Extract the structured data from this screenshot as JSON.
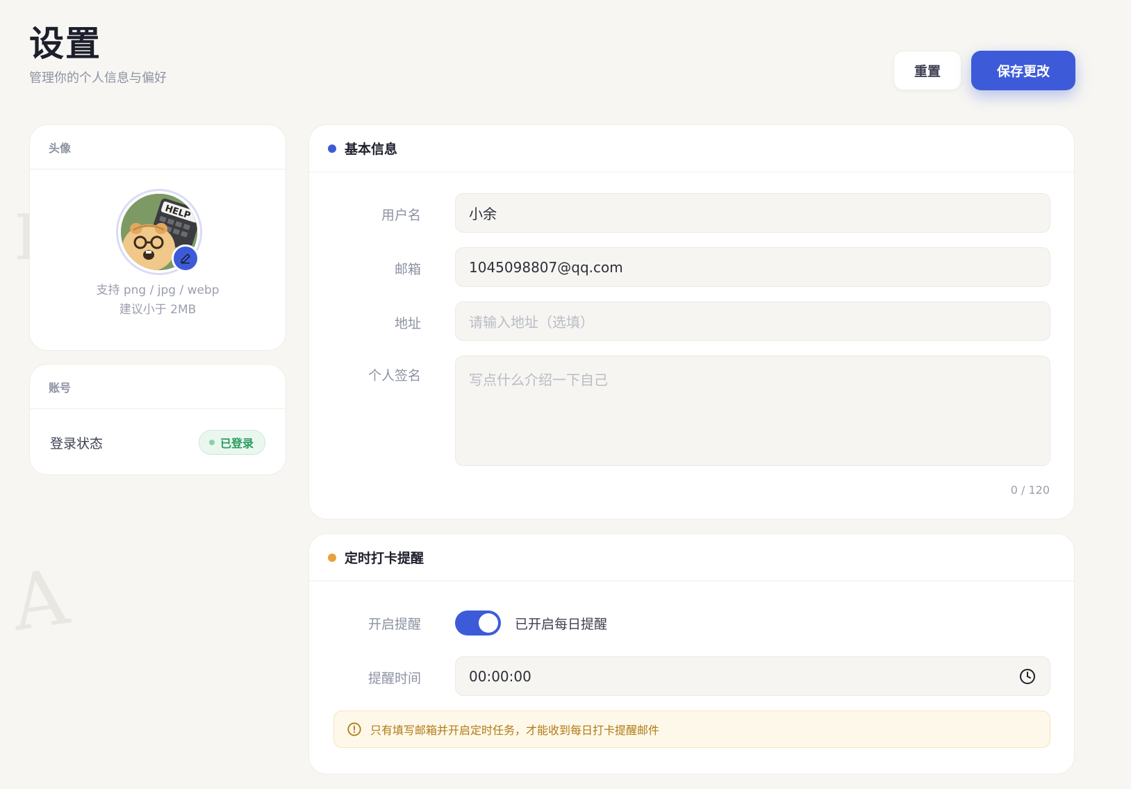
{
  "header": {
    "title": "设置",
    "subtitle": "管理你的个人信息与偏好",
    "reset_label": "重置",
    "save_label": "保存更改"
  },
  "avatar_card": {
    "title": "头像",
    "hint_line1": "支持 png / jpg / webp",
    "hint_line2": "建议小于 2MB",
    "avatar_text": "HELP"
  },
  "account_card": {
    "title": "账号",
    "login_label": "登录状态",
    "login_status": "已登录"
  },
  "basic_info": {
    "title": "基本信息",
    "username_label": "用户名",
    "username_value": "小余",
    "email_label": "邮箱",
    "email_value": "1045098807@qq.com",
    "address_label": "地址",
    "address_placeholder": "请输入地址（选填）",
    "signature_label": "个人签名",
    "signature_placeholder": "写点什么介绍一下自己",
    "signature_counter": "0 / 120"
  },
  "reminder": {
    "title": "定时打卡提醒",
    "enable_label": "开启提醒",
    "enabled": true,
    "enabled_text": "已开启每日提醒",
    "time_label": "提醒时间",
    "time_value": "00:00:00",
    "notice": "只有填写邮箱并开启定时任务，才能收到每日打卡提醒邮件"
  },
  "colors": {
    "accent": "#3d5bd9",
    "basic_dot": "#3d5bd9",
    "reminder_dot": "#e8a23c",
    "success": "#2a9a5d",
    "warning": "#b07a12"
  },
  "icons": {
    "edit": "pencil-icon",
    "clock": "clock-icon",
    "notice": "warning-circle-icon"
  }
}
